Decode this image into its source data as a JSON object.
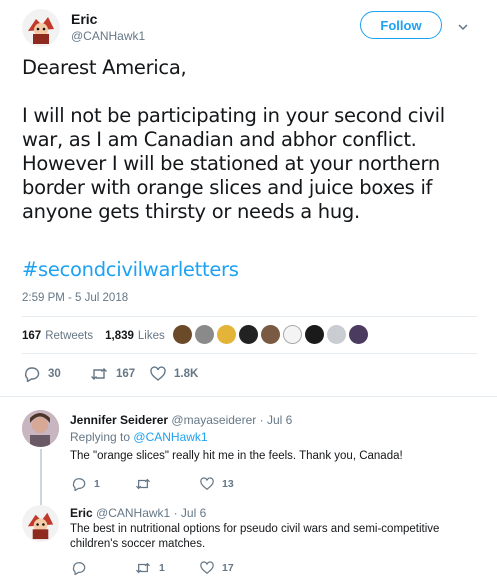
{
  "tweet": {
    "author_name": "Eric",
    "author_handle": "@CANHawk1",
    "follow_label": "Follow",
    "body": "Dearest America,\n\nI will not be participating in your second civil war, as I am Canadian and abhor conflict. However I will be stationed at your northern border with orange slices and juice boxes if anyone gets thirsty or needs a hug.",
    "hashtag": "#secondcivilwarletters",
    "timestamp": "2:59 PM - 5 Jul 2018",
    "retweets_count": "167",
    "retweets_label": "Retweets",
    "likes_count": "1,839",
    "likes_label": "Likes",
    "actions": {
      "replies": "30",
      "retweets": "167",
      "likes": "1.8K"
    }
  },
  "replies": [
    {
      "name": "Jennifer Seiderer",
      "handle": "@mayaseiderer",
      "time": "· Jul 6",
      "replying_prefix": "Replying to",
      "replying_to": "@CANHawk1",
      "text": "The \"orange slices\" really hit me in the feels.  Thank you, Canada!",
      "actions": {
        "replies": "1",
        "retweets": "",
        "likes": "13"
      }
    },
    {
      "name": "Eric",
      "handle": "@CANHawk1",
      "time": "· Jul 6",
      "text": "The best in nutritional options for pseudo civil wars and semi-competitive children's soccer matches.",
      "actions": {
        "replies": "",
        "retweets": "1",
        "likes": "17"
      }
    }
  ],
  "colors": {
    "accent": "#1da1f2",
    "muted": "#657786",
    "text": "#14171a",
    "divider": "#e6ecf0"
  },
  "icons": [
    "reply-icon",
    "retweet-icon",
    "like-icon",
    "chevron-down-icon"
  ]
}
